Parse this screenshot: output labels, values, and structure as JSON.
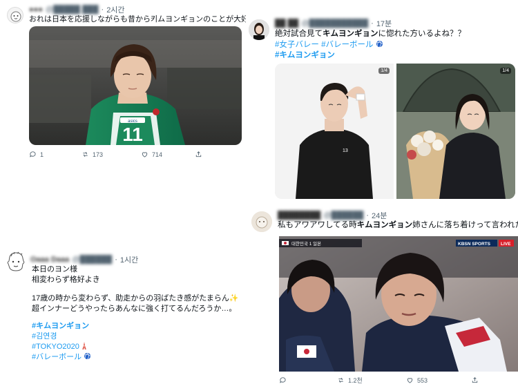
{
  "tweet1": {
    "display_name": "●●●",
    "handle": "@█████ ███",
    "dot": "·",
    "time": "2시간",
    "text": "おれは日本を応援しながらも昔から키ムヨンギョンのことが大好きなんよ",
    "replies": "1",
    "retweets": "173",
    "likes": "714"
  },
  "tweet2": {
    "display_name": "██ ██",
    "handle": "@███████████",
    "dot": "·",
    "time": "17분",
    "line1_pre": "絶対試合見て",
    "line1_bold": "キムヨンギョン",
    "line1_post": "に惚れた方いるよね？？",
    "tags_line2": "#女子バレー #バレーボール",
    "tag_line3": "#キムヨンギョン",
    "photo1_badge": "1/4",
    "photo2_badge": "1/4"
  },
  "tweet3": {
    "display_name": "Oaaa Daaa",
    "handle": "@██████",
    "dot": "·",
    "time": "1시간",
    "line1": "本日のヨン様",
    "line2": "相変わらず格好よき",
    "line3": "17歳の時から変わらず、助走からの羽ばたき感がたまらん✨",
    "line4": "超インナーどうやったらあんなに強く打てるんだろうか…。",
    "tag1": "#キムヨンギョン",
    "tag2": "#김연경",
    "tag3": "#TOKYO2020",
    "tag4": "#バレーボール"
  },
  "tweet4": {
    "display_name": "████████",
    "handle": "@██████",
    "dot": "·",
    "time": "24분",
    "text_pre": "私もアワアワしてる時",
    "text_bold": "キムヨンギョン",
    "text_post": "姉さんに落ち着けって言われたい",
    "broadcaster": "KBSN SPORTS",
    "live": "LIVE",
    "score_text": "대한민국 1 일본",
    "retweets": "1.2천",
    "likes": "553"
  },
  "colors": {
    "accent": "#1d9bf0",
    "text": "#0f1419",
    "muted": "#536471"
  }
}
